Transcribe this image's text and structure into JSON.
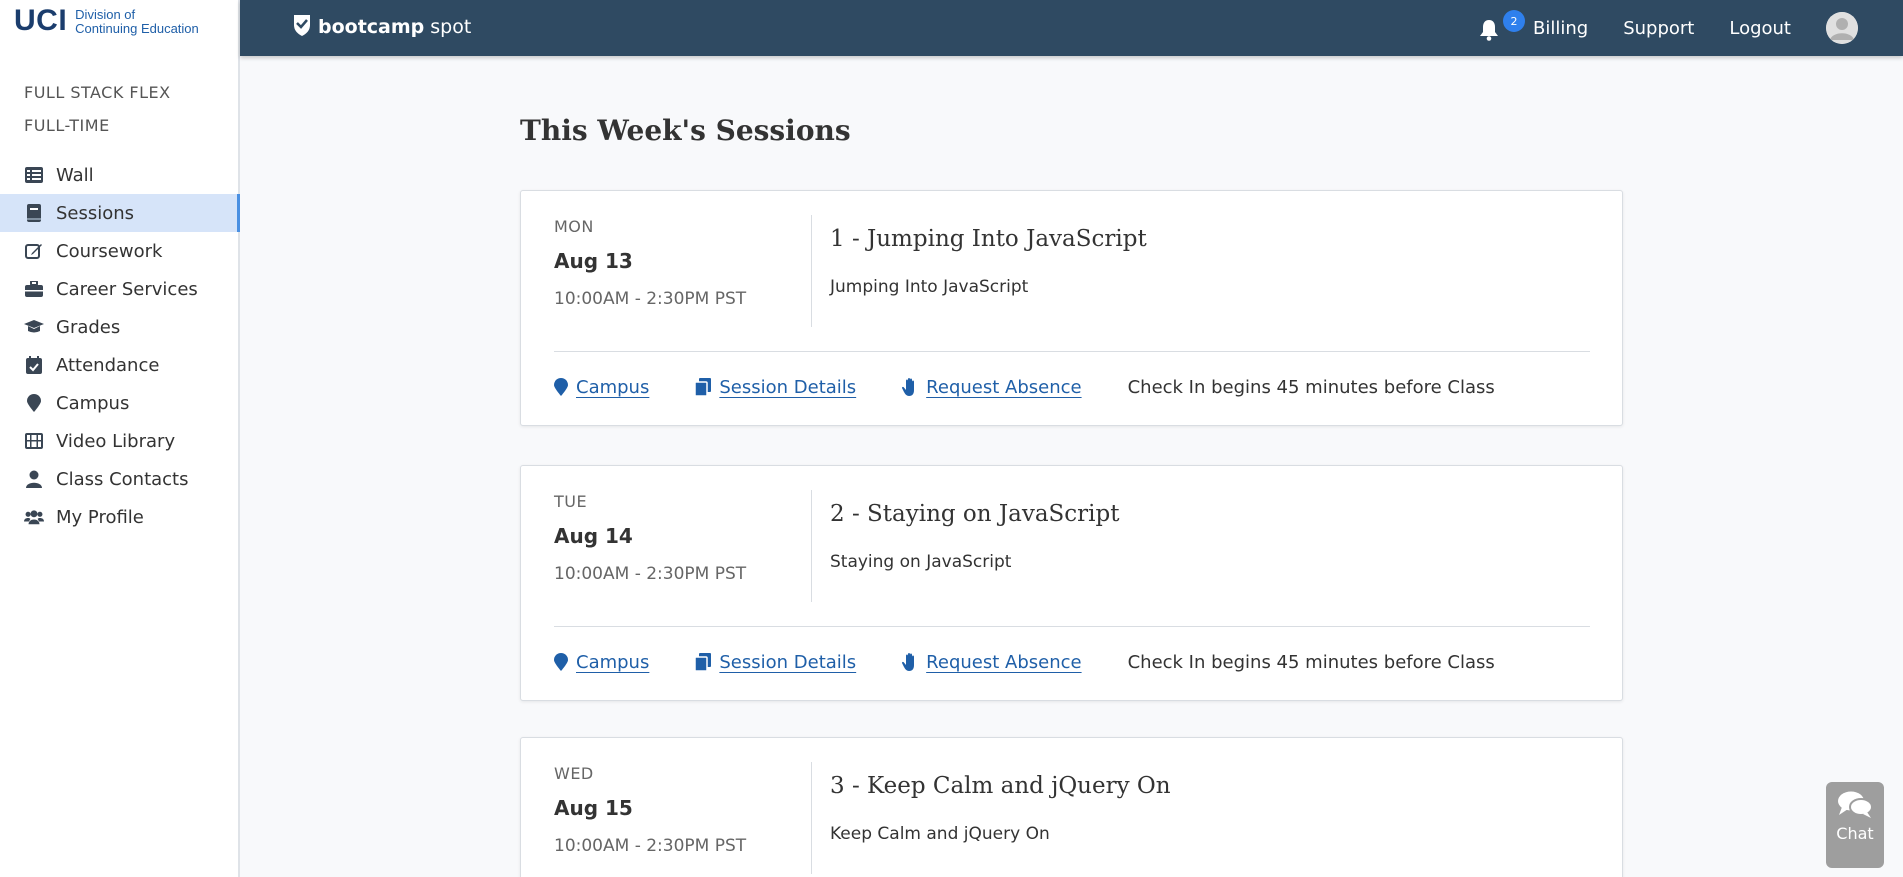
{
  "logo": {
    "org": "UCI",
    "division_line1": "Division of",
    "division_line2": "Continuing Education"
  },
  "sidebar": {
    "course_title": "FULL STACK FLEX FULL-TIME",
    "items": [
      {
        "label": "Wall",
        "icon": "list-icon"
      },
      {
        "label": "Sessions",
        "icon": "book-icon",
        "active": true
      },
      {
        "label": "Coursework",
        "icon": "edit-icon"
      },
      {
        "label": "Career Services",
        "icon": "briefcase-icon"
      },
      {
        "label": "Grades",
        "icon": "graduation-cap-icon"
      },
      {
        "label": "Attendance",
        "icon": "calendar-check-icon"
      },
      {
        "label": "Campus",
        "icon": "map-marker-icon"
      },
      {
        "label": "Video Library",
        "icon": "film-icon"
      },
      {
        "label": "Class Contacts",
        "icon": "user-icon"
      },
      {
        "label": "My Profile",
        "icon": "users-icon"
      }
    ]
  },
  "topbar": {
    "brand_bold": "bootcamp",
    "brand_light": "spot",
    "notification_count": "2",
    "links": {
      "billing": "Billing",
      "support": "Support",
      "logout": "Logout"
    }
  },
  "main": {
    "title": "This Week's Sessions",
    "sessions": [
      {
        "dow": "MON",
        "date": "Aug 13",
        "time": "10:00AM - 2:30PM PST",
        "title": "1 - Jumping Into JavaScript",
        "subtitle": "Jumping Into JavaScript",
        "campus": "Campus",
        "details": "Session Details",
        "absence": "Request Absence",
        "checkin": "Check In begins 45 minutes before Class"
      },
      {
        "dow": "TUE",
        "date": "Aug 14",
        "time": "10:00AM - 2:30PM PST",
        "title": "2 - Staying on JavaScript",
        "subtitle": "Staying on JavaScript",
        "campus": "Campus",
        "details": "Session Details",
        "absence": "Request Absence",
        "checkin": "Check In begins 45 minutes before Class"
      },
      {
        "dow": "WED",
        "date": "Aug 15",
        "time": "10:00AM - 2:30PM PST",
        "title": "3 - Keep Calm and jQuery On",
        "subtitle": "Keep Calm and jQuery On"
      }
    ]
  },
  "chat": {
    "label": "Chat"
  },
  "colors": {
    "topbar": "#2f4a62",
    "link": "#1f5fa8",
    "active_nav": "#d6e4f9",
    "badge": "#2f80ed"
  }
}
